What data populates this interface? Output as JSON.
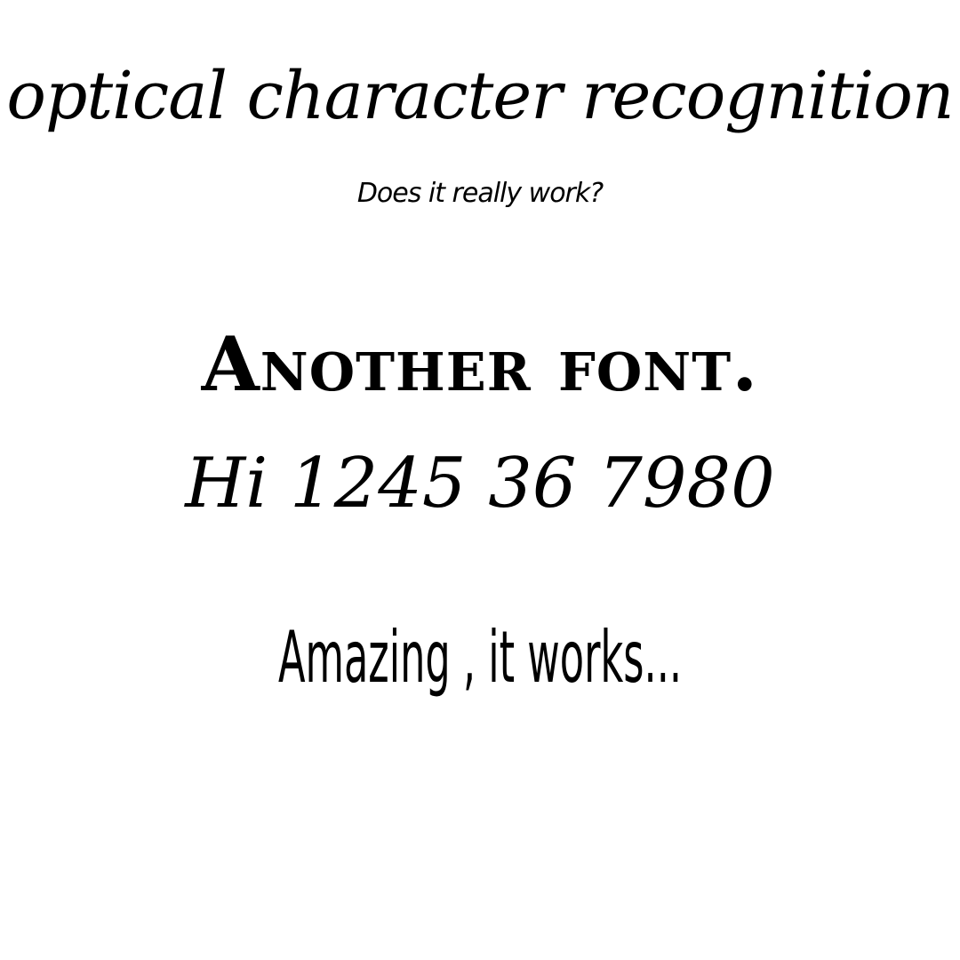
{
  "document": {
    "title": "optical character recognition",
    "subtitle": "Does it really work?",
    "line_another_font": "Another font.",
    "line_numbers": "Hi 1245 36 7980",
    "line_amazing": "Amazing , it works..."
  },
  "colors": {
    "background": "#ffffff",
    "text": "#000000"
  }
}
